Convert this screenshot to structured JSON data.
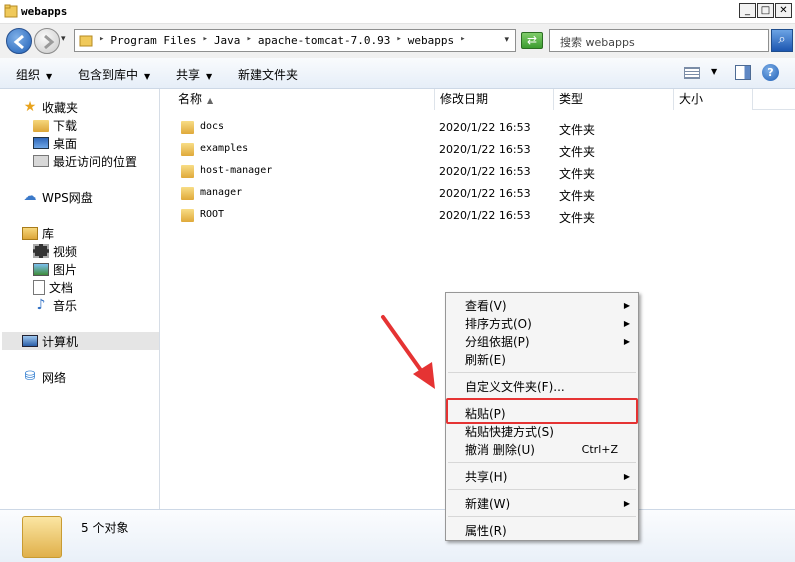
{
  "window": {
    "title": "webapps",
    "minimize_glyph": "_",
    "maximize_glyph": "□",
    "close_glyph": "✕"
  },
  "address": {
    "crumbs": [
      "Program Files",
      "Java",
      "apache-tomcat-7.0.93",
      "webapps"
    ],
    "search_placeholder": "搜索 webapps"
  },
  "toolbar": {
    "organize": "组织",
    "include_library": "包含到库中",
    "share": "共享",
    "new_folder": "新建文件夹"
  },
  "sidebar": {
    "favorites": "收藏夹",
    "downloads": "下载",
    "desktop": "桌面",
    "recent": "最近访问的位置",
    "wps": "WPS网盘",
    "libraries": "库",
    "videos": "视频",
    "pictures": "图片",
    "documents": "文档",
    "music": "音乐",
    "computer": "计算机",
    "network": "网络"
  },
  "columns": {
    "name": "名称",
    "modified": "修改日期",
    "type": "类型",
    "size": "大小"
  },
  "files": [
    {
      "name": "docs",
      "modified": "2020/1/22 16:53",
      "type": "文件夹"
    },
    {
      "name": "examples",
      "modified": "2020/1/22 16:53",
      "type": "文件夹"
    },
    {
      "name": "host-manager",
      "modified": "2020/1/22 16:53",
      "type": "文件夹"
    },
    {
      "name": "manager",
      "modified": "2020/1/22 16:53",
      "type": "文件夹"
    },
    {
      "name": "ROOT",
      "modified": "2020/1/22 16:53",
      "type": "文件夹"
    }
  ],
  "status": {
    "object_count": "5 个对象"
  },
  "context_menu": {
    "view": "查看(V)",
    "sort_by": "排序方式(O)",
    "group_by": "分组依据(P)",
    "refresh": "刷新(E)",
    "customize": "自定义文件夹(F)...",
    "paste": "粘贴(P)",
    "paste_shortcut": "粘贴快捷方式(S)",
    "undo_delete": "撤消 删除(U)",
    "undo_shortcut": "Ctrl+Z",
    "share_with": "共享(H)",
    "new": "新建(W)",
    "properties": "属性(R)"
  },
  "colors": {
    "highlight_box": "#e53333",
    "annotation_arrow": "#e53333",
    "folder": "#e8b948"
  }
}
